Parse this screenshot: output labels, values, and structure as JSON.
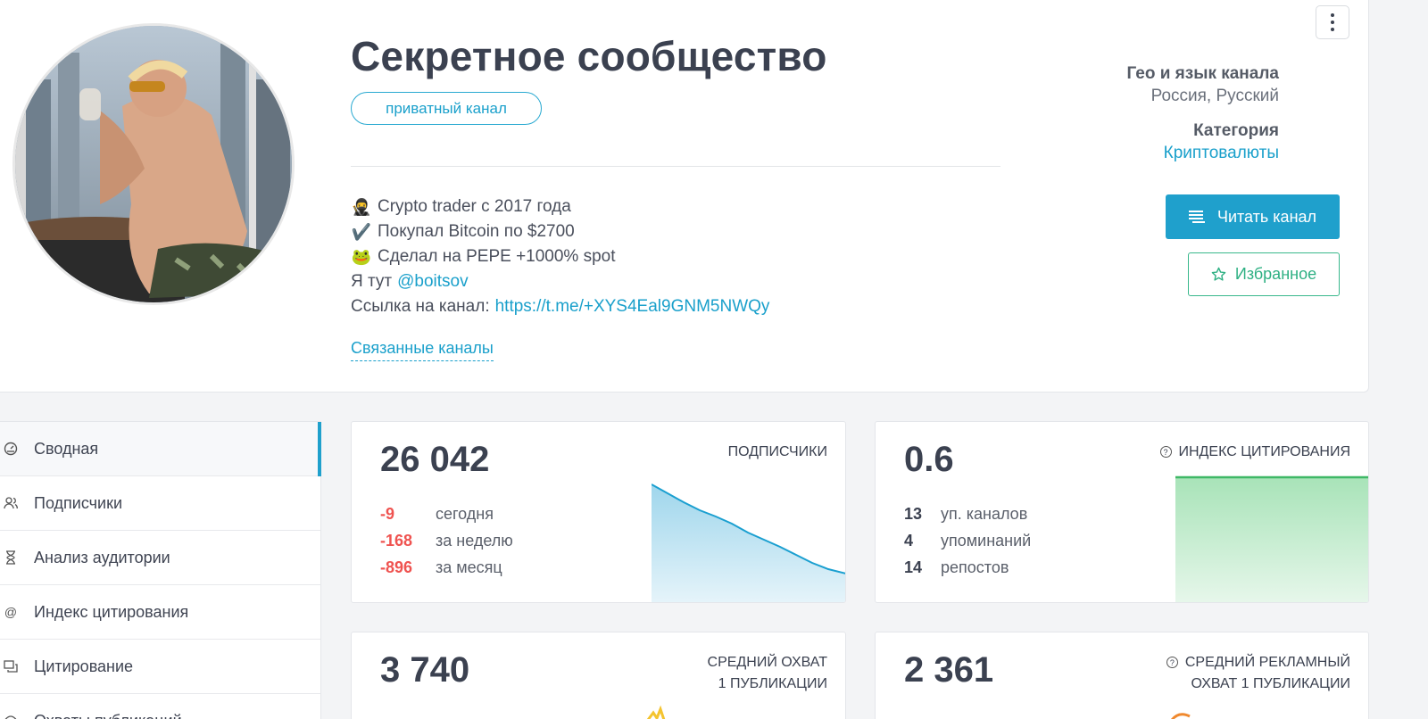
{
  "channel": {
    "title": "Секретное сообщество",
    "badge": "приватный канал",
    "description": [
      {
        "emoji": "🥷",
        "text": "Crypto trader с 2017 года"
      },
      {
        "emoji": "✔️",
        "text": "Покупал Bitcoin по $2700"
      },
      {
        "emoji": "🐸",
        "text": "Сделал на PEPE +1000% spot"
      }
    ],
    "here_prefix": "Я тут",
    "here_handle": "@boitsov",
    "link_prefix": "Ссылка на канал:",
    "link_url": "https://t.me/+XYS4Eal9GNM5NWQy",
    "related_label": "Связанные каналы"
  },
  "meta": {
    "geo_label": "Гео и язык канала",
    "geo_value": "Россия, Русский",
    "category_label": "Категория",
    "category_value": "Криптовалюты"
  },
  "actions": {
    "read_label": "Читать канал",
    "fav_label": "Избранное"
  },
  "sidebar": {
    "items": [
      {
        "label": "Сводная",
        "icon": "dashboard-icon"
      },
      {
        "label": "Подписчики",
        "icon": "users-icon"
      },
      {
        "label": "Анализ аудитории",
        "icon": "hourglass-icon"
      },
      {
        "label": "Индекс цитирования",
        "icon": "at-icon"
      },
      {
        "label": "Цитирование",
        "icon": "quote-icon"
      },
      {
        "label": "Охваты публикаций",
        "icon": "reach-icon"
      }
    ]
  },
  "stats": {
    "subscribers": {
      "value": "26 042",
      "label": "ПОДПИСЧИКИ",
      "rows": [
        {
          "num": "-9",
          "text": "сегодня"
        },
        {
          "num": "-168",
          "text": "за неделю"
        },
        {
          "num": "-896",
          "text": "за месяц"
        }
      ]
    },
    "citation": {
      "value": "0.6",
      "label": "ИНДЕКС ЦИТИРОВАНИЯ",
      "rows": [
        {
          "num": "13",
          "text": "уп. каналов"
        },
        {
          "num": "4",
          "text": "упоминаний"
        },
        {
          "num": "14",
          "text": "репостов"
        }
      ]
    },
    "avg_reach": {
      "value": "3 740",
      "label_line1": "СРЕДНИЙ ОХВАТ",
      "label_line2": "1 ПУБЛИКАЦИИ"
    },
    "ad_reach": {
      "value": "2 361",
      "label_line1": "СРЕДНИЙ РЕКЛАМНЫЙ",
      "label_line2": "ОХВАТ 1 ПУБЛИКАЦИИ"
    }
  },
  "colors": {
    "accent": "#1fa0cc",
    "favorite": "#2eb083",
    "negative": "#ef5350",
    "citation_fill": "#5cc97c"
  }
}
